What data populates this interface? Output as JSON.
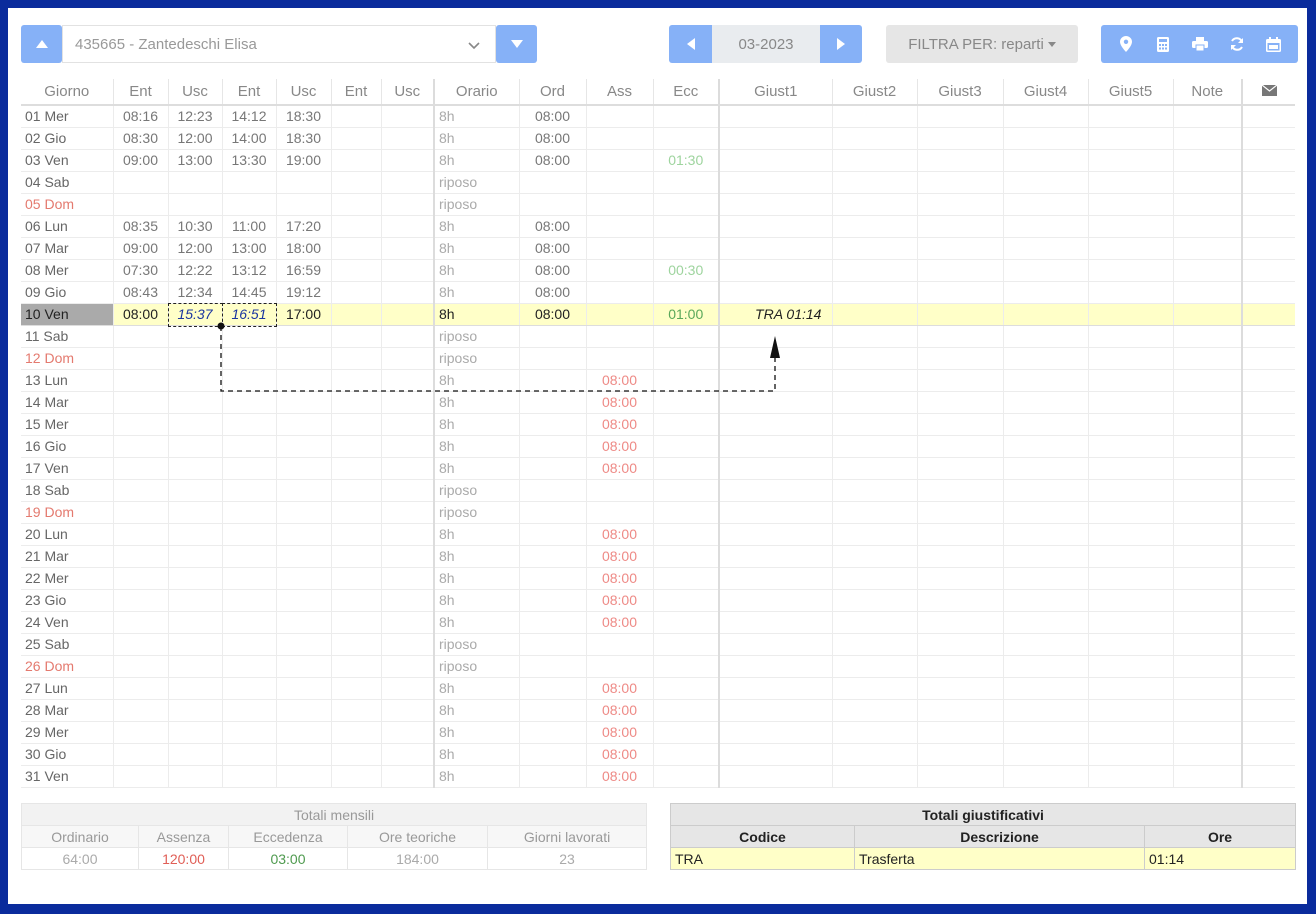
{
  "employee": {
    "value": "435665 - Zantedeschi Elisa"
  },
  "period": {
    "value": "03-2023"
  },
  "filter": {
    "label": "FILTRA PER: reparti"
  },
  "toolbar": {
    "icons": [
      "map-marker-icon",
      "calculator-icon",
      "print-icon",
      "refresh-icon",
      "calendar-icon"
    ]
  },
  "columns": [
    "Giorno",
    "Ent",
    "Usc",
    "Ent",
    "Usc",
    "Ent",
    "Usc",
    "Orario",
    "Ord",
    "Ass",
    "Ecc",
    "Giust1",
    "Giust2",
    "Giust3",
    "Giust4",
    "Giust5",
    "Note"
  ],
  "rows": [
    {
      "day": "01 Mer",
      "t": [
        "08:16",
        "12:23",
        "14:12",
        "18:30",
        "",
        ""
      ],
      "orario": "8h",
      "ord": "08:00",
      "ass": "",
      "ecc": "",
      "giust1": ""
    },
    {
      "day": "02 Gio",
      "t": [
        "08:30",
        "12:00",
        "14:00",
        "18:30",
        "",
        ""
      ],
      "orario": "8h",
      "ord": "08:00",
      "ass": "",
      "ecc": "",
      "giust1": ""
    },
    {
      "day": "03 Ven",
      "t": [
        "09:00",
        "13:00",
        "13:30",
        "19:00",
        "",
        ""
      ],
      "orario": "8h",
      "ord": "08:00",
      "ass": "",
      "ecc": "01:30",
      "giust1": ""
    },
    {
      "day": "04 Sab",
      "t": [
        "",
        "",
        "",
        "",
        "",
        ""
      ],
      "orario": "riposo",
      "ord": "",
      "ass": "",
      "ecc": "",
      "giust1": ""
    },
    {
      "day": "05 Dom",
      "t": [
        "",
        "",
        "",
        "",
        "",
        ""
      ],
      "orario": "riposo",
      "ord": "",
      "ass": "",
      "ecc": "",
      "giust1": ""
    },
    {
      "day": "06 Lun",
      "t": [
        "08:35",
        "10:30",
        "11:00",
        "17:20",
        "",
        ""
      ],
      "orario": "8h",
      "ord": "08:00",
      "ass": "",
      "ecc": "",
      "giust1": ""
    },
    {
      "day": "07 Mar",
      "t": [
        "09:00",
        "12:00",
        "13:00",
        "18:00",
        "",
        ""
      ],
      "orario": "8h",
      "ord": "08:00",
      "ass": "",
      "ecc": "",
      "giust1": ""
    },
    {
      "day": "08 Mer",
      "t": [
        "07:30",
        "12:22",
        "13:12",
        "16:59",
        "",
        ""
      ],
      "orario": "8h",
      "ord": "08:00",
      "ass": "",
      "ecc": "00:30",
      "giust1": ""
    },
    {
      "day": "09 Gio",
      "t": [
        "08:43",
        "12:34",
        "14:45",
        "19:12",
        "",
        ""
      ],
      "orario": "8h",
      "ord": "08:00",
      "ass": "",
      "ecc": "",
      "giust1": ""
    },
    {
      "day": "10 Ven",
      "t": [
        "08:00",
        "15:37",
        "16:51",
        "17:00",
        "",
        ""
      ],
      "orario": "8h",
      "ord": "08:00",
      "ass": "",
      "ecc": "01:00",
      "giust1": "TRA 01:14"
    },
    {
      "day": "11 Sab",
      "t": [
        "",
        "",
        "",
        "",
        "",
        ""
      ],
      "orario": "riposo",
      "ord": "",
      "ass": "",
      "ecc": "",
      "giust1": ""
    },
    {
      "day": "12 Dom",
      "t": [
        "",
        "",
        "",
        "",
        "",
        ""
      ],
      "orario": "riposo",
      "ord": "",
      "ass": "",
      "ecc": "",
      "giust1": ""
    },
    {
      "day": "13 Lun",
      "t": [
        "",
        "",
        "",
        "",
        "",
        ""
      ],
      "orario": "8h",
      "ord": "",
      "ass": "08:00",
      "ecc": "",
      "giust1": ""
    },
    {
      "day": "14 Mar",
      "t": [
        "",
        "",
        "",
        "",
        "",
        ""
      ],
      "orario": "8h",
      "ord": "",
      "ass": "08:00",
      "ecc": "",
      "giust1": ""
    },
    {
      "day": "15 Mer",
      "t": [
        "",
        "",
        "",
        "",
        "",
        ""
      ],
      "orario": "8h",
      "ord": "",
      "ass": "08:00",
      "ecc": "",
      "giust1": ""
    },
    {
      "day": "16 Gio",
      "t": [
        "",
        "",
        "",
        "",
        "",
        ""
      ],
      "orario": "8h",
      "ord": "",
      "ass": "08:00",
      "ecc": "",
      "giust1": ""
    },
    {
      "day": "17 Ven",
      "t": [
        "",
        "",
        "",
        "",
        "",
        ""
      ],
      "orario": "8h",
      "ord": "",
      "ass": "08:00",
      "ecc": "",
      "giust1": ""
    },
    {
      "day": "18 Sab",
      "t": [
        "",
        "",
        "",
        "",
        "",
        ""
      ],
      "orario": "riposo",
      "ord": "",
      "ass": "",
      "ecc": "",
      "giust1": ""
    },
    {
      "day": "19 Dom",
      "t": [
        "",
        "",
        "",
        "",
        "",
        ""
      ],
      "orario": "riposo",
      "ord": "",
      "ass": "",
      "ecc": "",
      "giust1": ""
    },
    {
      "day": "20 Lun",
      "t": [
        "",
        "",
        "",
        "",
        "",
        ""
      ],
      "orario": "8h",
      "ord": "",
      "ass": "08:00",
      "ecc": "",
      "giust1": ""
    },
    {
      "day": "21 Mar",
      "t": [
        "",
        "",
        "",
        "",
        "",
        ""
      ],
      "orario": "8h",
      "ord": "",
      "ass": "08:00",
      "ecc": "",
      "giust1": ""
    },
    {
      "day": "22 Mer",
      "t": [
        "",
        "",
        "",
        "",
        "",
        ""
      ],
      "orario": "8h",
      "ord": "",
      "ass": "08:00",
      "ecc": "",
      "giust1": ""
    },
    {
      "day": "23 Gio",
      "t": [
        "",
        "",
        "",
        "",
        "",
        ""
      ],
      "orario": "8h",
      "ord": "",
      "ass": "08:00",
      "ecc": "",
      "giust1": ""
    },
    {
      "day": "24 Ven",
      "t": [
        "",
        "",
        "",
        "",
        "",
        ""
      ],
      "orario": "8h",
      "ord": "",
      "ass": "08:00",
      "ecc": "",
      "giust1": ""
    },
    {
      "day": "25 Sab",
      "t": [
        "",
        "",
        "",
        "",
        "",
        ""
      ],
      "orario": "riposo",
      "ord": "",
      "ass": "",
      "ecc": "",
      "giust1": ""
    },
    {
      "day": "26 Dom",
      "t": [
        "",
        "",
        "",
        "",
        "",
        ""
      ],
      "orario": "riposo",
      "ord": "",
      "ass": "",
      "ecc": "",
      "giust1": ""
    },
    {
      "day": "27 Lun",
      "t": [
        "",
        "",
        "",
        "",
        "",
        ""
      ],
      "orario": "8h",
      "ord": "",
      "ass": "08:00",
      "ecc": "",
      "giust1": ""
    },
    {
      "day": "28 Mar",
      "t": [
        "",
        "",
        "",
        "",
        "",
        ""
      ],
      "orario": "8h",
      "ord": "",
      "ass": "08:00",
      "ecc": "",
      "giust1": ""
    },
    {
      "day": "29 Mer",
      "t": [
        "",
        "",
        "",
        "",
        "",
        ""
      ],
      "orario": "8h",
      "ord": "",
      "ass": "08:00",
      "ecc": "",
      "giust1": ""
    },
    {
      "day": "30 Gio",
      "t": [
        "",
        "",
        "",
        "",
        "",
        ""
      ],
      "orario": "8h",
      "ord": "",
      "ass": "08:00",
      "ecc": "",
      "giust1": ""
    },
    {
      "day": "31 Ven",
      "t": [
        "",
        "",
        "",
        "",
        "",
        ""
      ],
      "orario": "8h",
      "ord": "",
      "ass": "08:00",
      "ecc": "",
      "giust1": ""
    }
  ],
  "totali_mensili": {
    "title": "Totali mensili",
    "headers": [
      "Ordinario",
      "Assenza",
      "Eccedenza",
      "Ore teoriche",
      "Giorni lavorati"
    ],
    "values": [
      "64:00",
      "120:00",
      "03:00",
      "184:00",
      "23"
    ]
  },
  "totali_giustificativi": {
    "title": "Totali giustificativi",
    "headers": [
      "Codice",
      "Descrizione",
      "Ore"
    ],
    "rows": [
      [
        "TRA",
        "Trasferta",
        "01:14"
      ]
    ]
  },
  "colors": {
    "accent": "#86b1f7",
    "frame": "#0a2b9c",
    "selected_row": "#ffffc8",
    "absence": "#ee8a86",
    "excess": "#9ed49e",
    "sunday": "#e47a6f"
  }
}
